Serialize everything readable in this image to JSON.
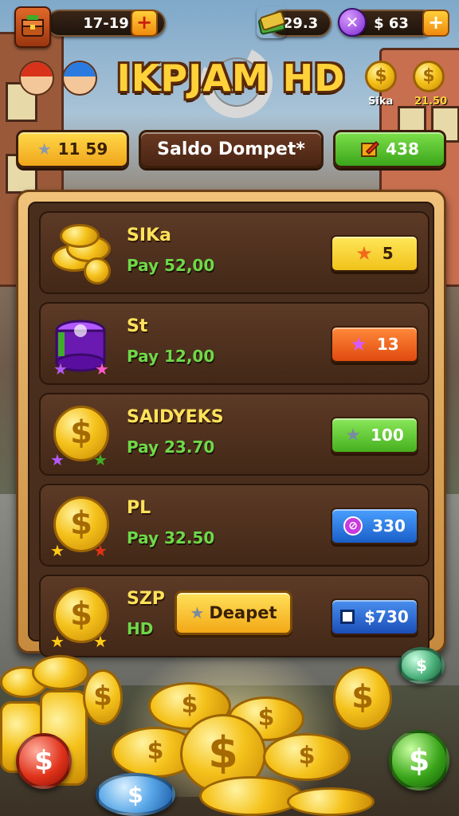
{
  "hud": {
    "lives_value": "17-19",
    "gems_value": "29.3",
    "cash_value": "$ 63",
    "plus_symbol": "+"
  },
  "header": {
    "logo": "IKPJAM HD",
    "badge_left_label": "Sika",
    "badge_right_label": "21.50"
  },
  "tabs": {
    "left_value": "11 59",
    "center_label": "Saldo Dompet*",
    "right_value": "438"
  },
  "rows": [
    {
      "name": "SIKa",
      "pay": "Pay 52,00",
      "button_value": "5",
      "button_color": "#f5d21e"
    },
    {
      "name": "St",
      "pay": "Pay 12,00",
      "button_value": "13",
      "button_color": "#f36a1a"
    },
    {
      "name": "SAIDYEKS",
      "pay": "Pay 23.70",
      "button_value": "100",
      "button_color": "#5cc52a"
    },
    {
      "name": "PL",
      "pay": "Pay 32.50",
      "button_value": "330",
      "button_color": "#2d7ee0"
    },
    {
      "name": "SZP",
      "pay": "HD",
      "button_value": "$730",
      "button_color": "#2d6fd6",
      "deposit_label": "Deapet"
    }
  ],
  "icons": {
    "star": "★",
    "dollar": "$"
  },
  "colors": {
    "gold": "#ffd23a",
    "pay_green": "#6fd84a",
    "panel_frame": "#d99a4a"
  }
}
